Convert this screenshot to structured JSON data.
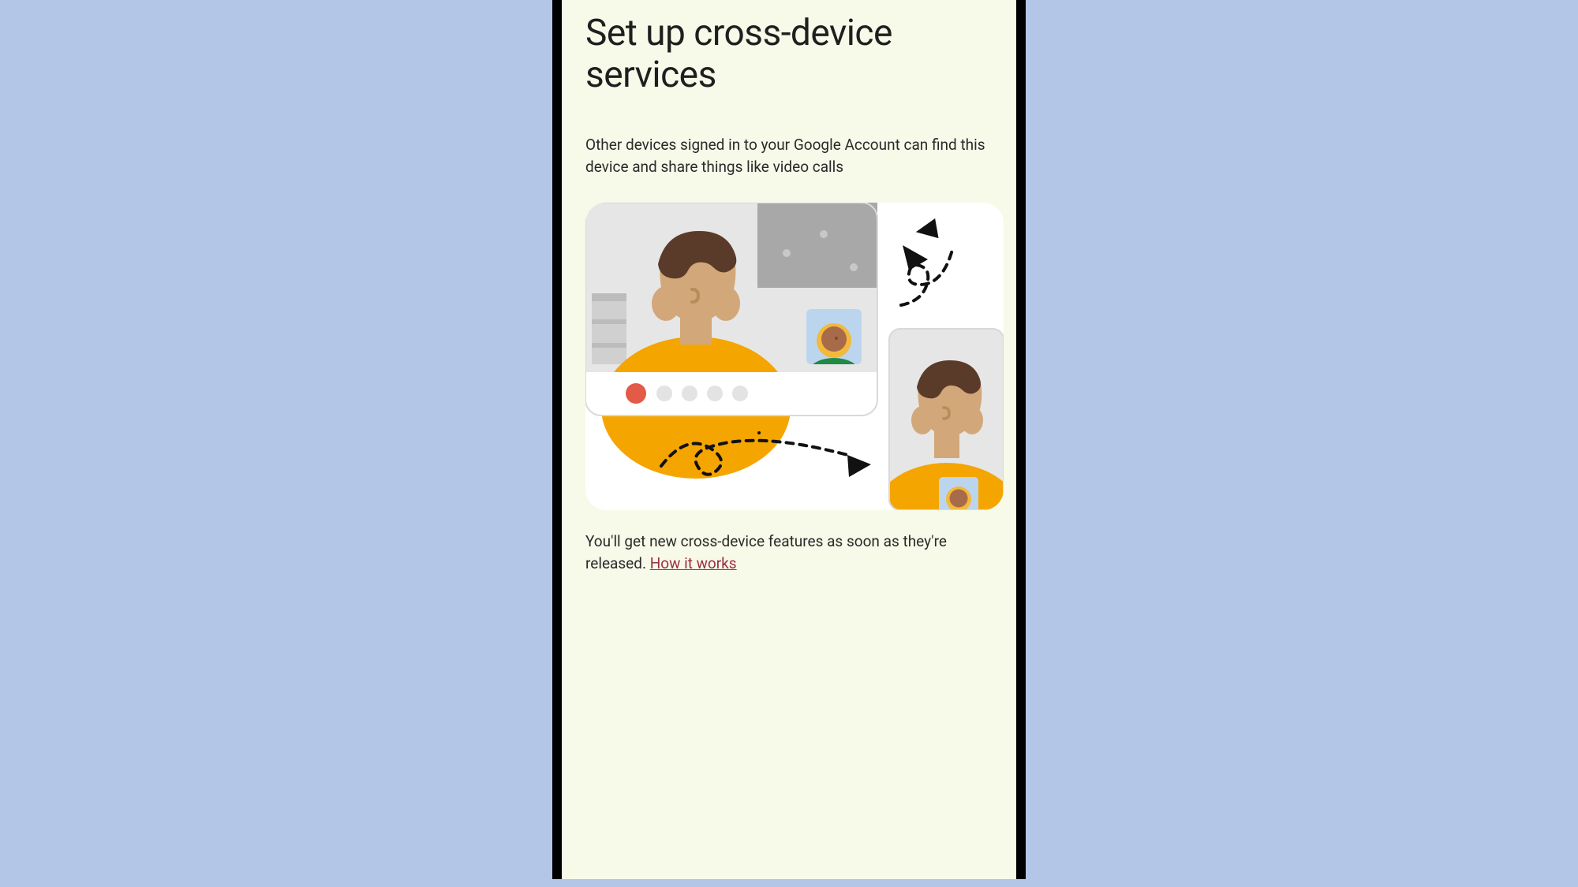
{
  "page": {
    "title": "Set up cross-device services",
    "description": "Other devices signed in to your Google Account can find this device and share things like video calls",
    "footer_prefix": "You'll get new cross-device features as soon as they're released. ",
    "footer_link": "How it works"
  },
  "illustration": {
    "name": "cross-device-video-call-illustration"
  }
}
